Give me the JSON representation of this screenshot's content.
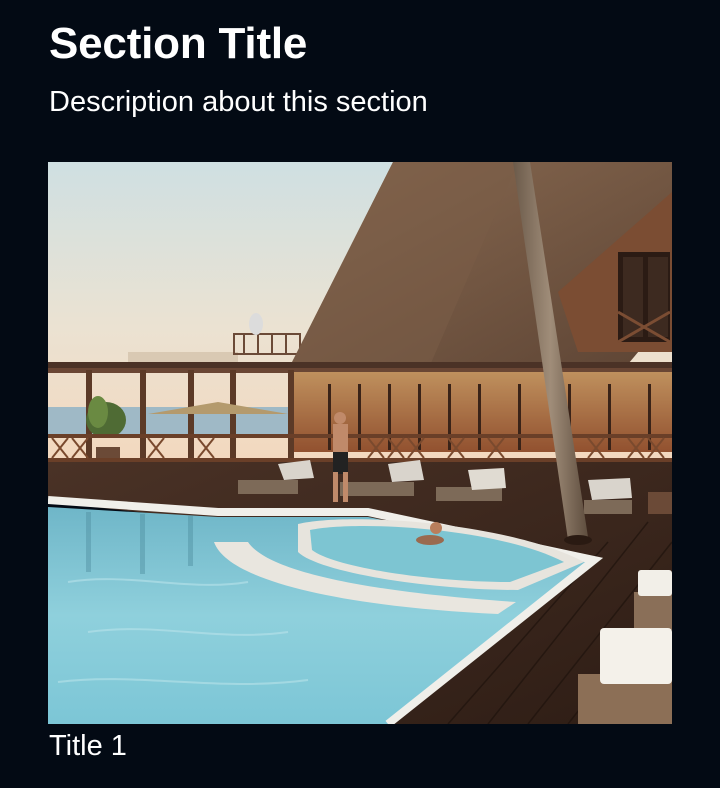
{
  "section": {
    "title": "Section Title",
    "description": "Description about this section"
  },
  "cards": [
    {
      "title": "Title 1",
      "image_alt": "Resort with wooden thatched-roof lodge beside a pool at dusk"
    }
  ]
}
